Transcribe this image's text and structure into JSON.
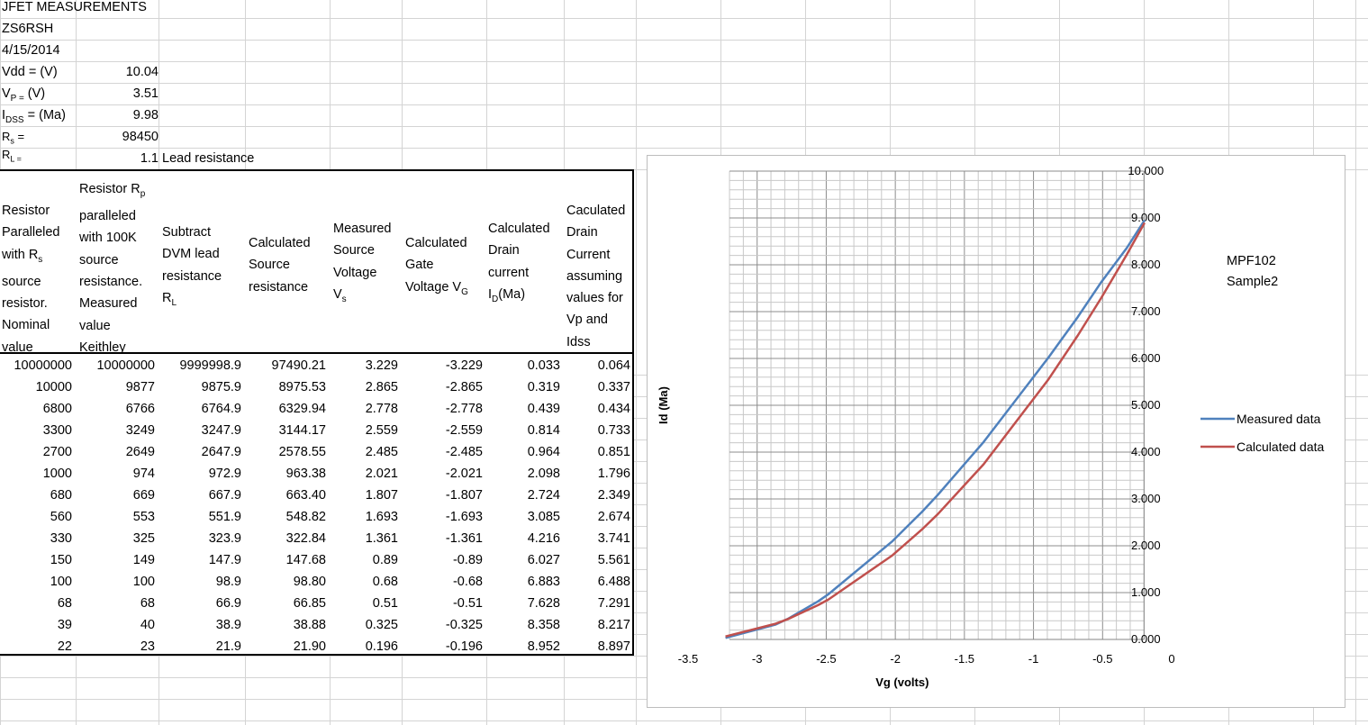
{
  "sheet": {
    "title": "JFET MEASUREMENTS",
    "callsign": "ZS6RSH",
    "date": "4/15/2014",
    "params": [
      {
        "label": "Vdd = (V)",
        "value": "10.04"
      },
      {
        "label": "VP = (V)",
        "value": "3.51"
      },
      {
        "label": "IDSS = (Ma)",
        "value": "9.98"
      },
      {
        "label": "Rs =",
        "value": "98450"
      },
      {
        "label": "RL =",
        "value": "1.1"
      }
    ],
    "lead_note": "Lead resistance"
  },
  "table": {
    "headers": [
      [
        "Resistor",
        "Paralleled",
        "with Rs",
        "source",
        "resistor.",
        "Nominal",
        "value"
      ],
      [
        "Resistor Rp",
        "paralleled",
        "with 100K",
        "source",
        "resistance.",
        "Measured",
        "value",
        "Keithley"
      ],
      [
        "Subtract",
        "DVM lead",
        "resistance",
        "RL"
      ],
      [
        "Calculated",
        "Source",
        "resistance"
      ],
      [
        "Measured",
        "Source",
        "Voltage",
        "Vs"
      ],
      [
        "Calculated",
        "Gate",
        "Voltage VG"
      ],
      [
        "Calculated",
        "Drain",
        "current",
        "ID(Ma)"
      ],
      [
        "Caculated",
        "Drain",
        "Current",
        "assuming",
        "values for",
        "Vp and",
        "Idss"
      ]
    ],
    "rows": [
      [
        "10000000",
        "10000000",
        "9999998.9",
        "97490.21",
        "3.229",
        "-3.229",
        "0.033",
        "0.064"
      ],
      [
        "10000",
        "9877",
        "9875.9",
        "8975.53",
        "2.865",
        "-2.865",
        "0.319",
        "0.337"
      ],
      [
        "6800",
        "6766",
        "6764.9",
        "6329.94",
        "2.778",
        "-2.778",
        "0.439",
        "0.434"
      ],
      [
        "3300",
        "3249",
        "3247.9",
        "3144.17",
        "2.559",
        "-2.559",
        "0.814",
        "0.733"
      ],
      [
        "2700",
        "2649",
        "2647.9",
        "2578.55",
        "2.485",
        "-2.485",
        "0.964",
        "0.851"
      ],
      [
        "1000",
        "974",
        "972.9",
        "963.38",
        "2.021",
        "-2.021",
        "2.098",
        "1.796"
      ],
      [
        "680",
        "669",
        "667.9",
        "663.40",
        "1.807",
        "-1.807",
        "2.724",
        "2.349"
      ],
      [
        "560",
        "553",
        "551.9",
        "548.82",
        "1.693",
        "-1.693",
        "3.085",
        "2.674"
      ],
      [
        "330",
        "325",
        "323.9",
        "322.84",
        "1.361",
        "-1.361",
        "4.216",
        "3.741"
      ],
      [
        "150",
        "149",
        "147.9",
        "147.68",
        "0.89",
        "-0.89",
        "6.027",
        "5.561"
      ],
      [
        "100",
        "100",
        "98.9",
        "98.80",
        "0.68",
        "-0.68",
        "6.883",
        "6.488"
      ],
      [
        "68",
        "68",
        "66.9",
        "66.85",
        "0.51",
        "-0.51",
        "7.628",
        "7.291"
      ],
      [
        "39",
        "40",
        "38.9",
        "38.88",
        "0.325",
        "-0.325",
        "8.358",
        "8.217"
      ],
      [
        "22",
        "23",
        "21.9",
        "21.90",
        "0.196",
        "-0.196",
        "8.952",
        "8.897"
      ]
    ]
  },
  "chart_data": {
    "type": "line",
    "title": "",
    "annotation": [
      "MPF102",
      "Sample2"
    ],
    "xlabel": "Vg (volts)",
    "ylabel": "Id (Ma)",
    "xlim": [
      -3.5,
      0
    ],
    "ylim": [
      0,
      10
    ],
    "x_ticks": [
      "-3.5",
      "-3",
      "-2.5",
      "-2",
      "-1.5",
      "-1",
      "-0.5",
      "0"
    ],
    "y_ticks": [
      "0.000",
      "1.000",
      "2.000",
      "3.000",
      "4.000",
      "5.000",
      "6.000",
      "7.000",
      "8.000",
      "9.000",
      "10.000"
    ],
    "grid": true,
    "legend_position": "right",
    "x": [
      -3.229,
      -2.865,
      -2.778,
      -2.559,
      -2.485,
      -2.021,
      -1.807,
      -1.693,
      -1.361,
      -0.89,
      -0.68,
      -0.51,
      -0.325,
      -0.196
    ],
    "series": [
      {
        "name": "Measured data",
        "color": "#4F81BD",
        "values": [
          0.033,
          0.319,
          0.439,
          0.814,
          0.964,
          2.098,
          2.724,
          3.085,
          4.216,
          6.027,
          6.883,
          7.628,
          8.358,
          8.952
        ]
      },
      {
        "name": "Calculated data",
        "color": "#C0504D",
        "values": [
          0.064,
          0.337,
          0.434,
          0.733,
          0.851,
          1.796,
          2.349,
          2.674,
          3.741,
          5.561,
          6.488,
          7.291,
          8.217,
          8.897
        ]
      }
    ]
  }
}
